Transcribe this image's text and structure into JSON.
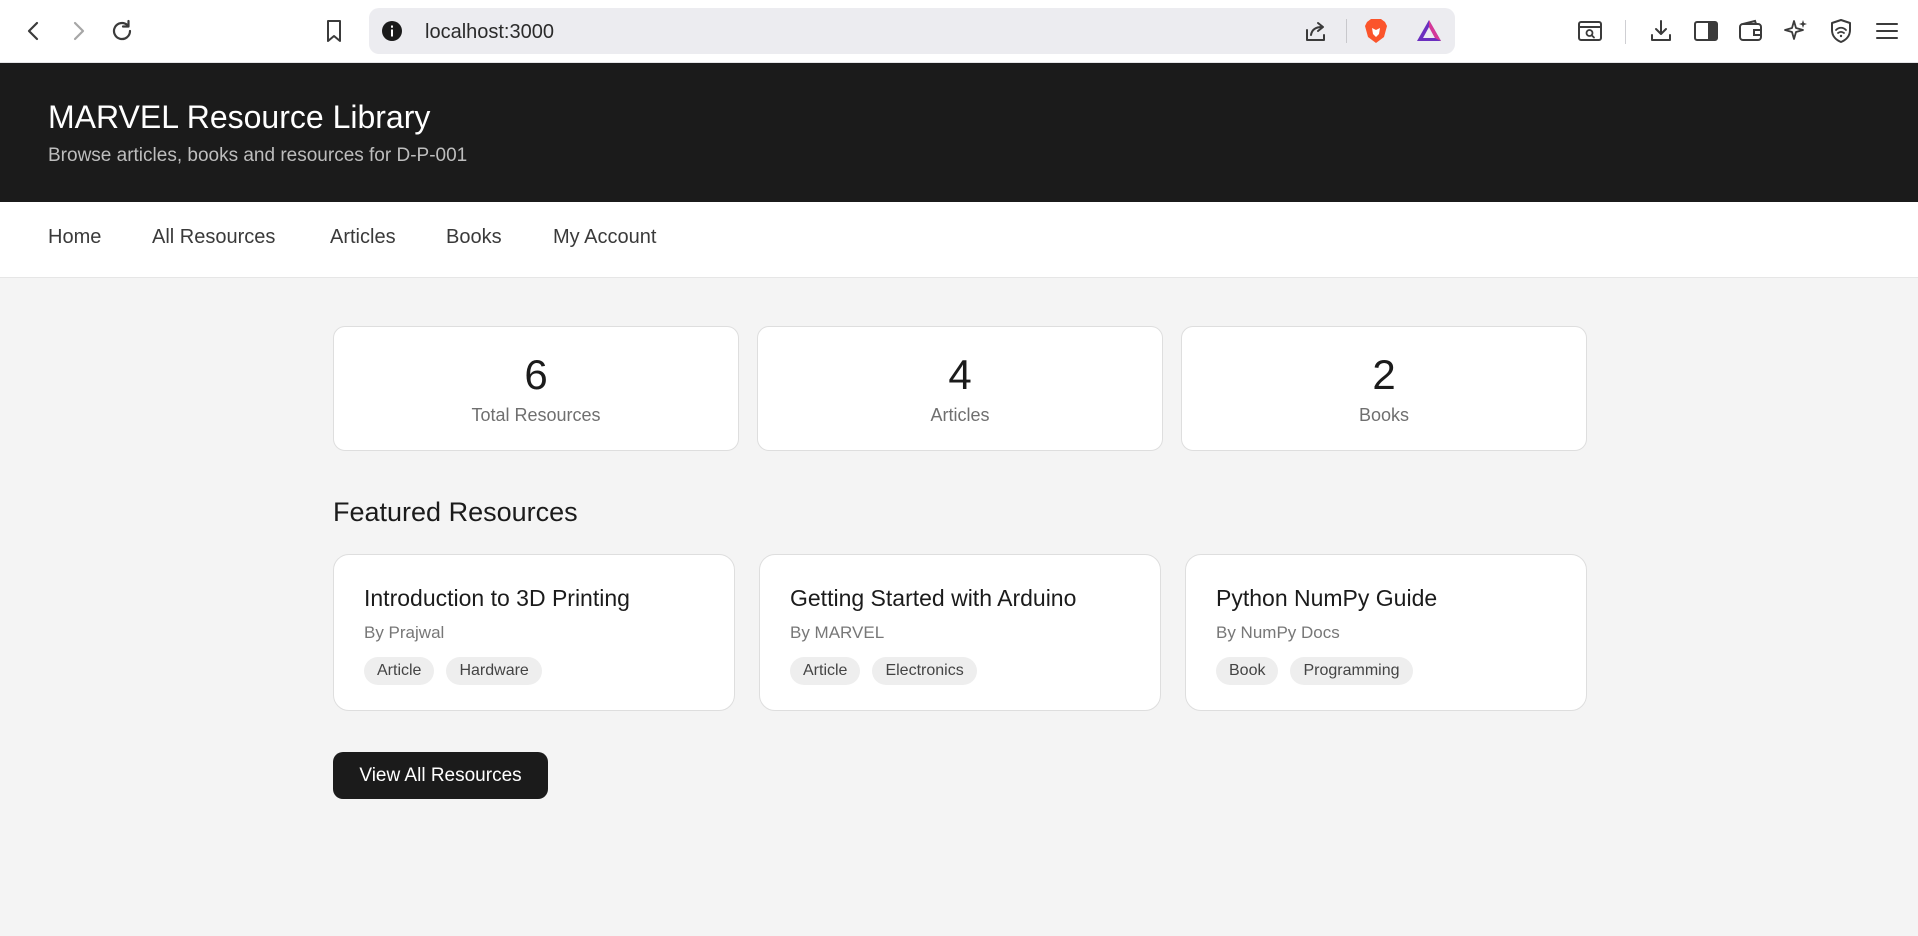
{
  "browser": {
    "url": "localhost:3000",
    "icons": [
      "back-icon",
      "forward-icon",
      "reload-icon",
      "bookmark-icon",
      "info-icon",
      "share-icon",
      "brave-shield-icon",
      "brave-rewards-icon",
      "tab-search-icon",
      "download-icon",
      "sidebar-icon",
      "wallet-icon",
      "leo-ai-icon",
      "vpn-icon",
      "menu-icon"
    ],
    "colors": {
      "brave_orange": "#fb542b",
      "rewards_purple": "#6b2fbf"
    }
  },
  "header": {
    "title": "MARVEL Resource Library",
    "subtitle": "Browse articles, books and resources for D-P-001"
  },
  "nav": {
    "items": [
      "Home",
      "All Resources",
      "Articles",
      "Books",
      "My Account"
    ]
  },
  "stats": [
    {
      "value": "6",
      "label": "Total Resources"
    },
    {
      "value": "4",
      "label": "Articles"
    },
    {
      "value": "2",
      "label": "Books"
    }
  ],
  "featured": {
    "heading": "Featured Resources",
    "items": [
      {
        "title": "Introduction to 3D Printing",
        "author": "By Prajwal",
        "tags": [
          "Article",
          "Hardware"
        ]
      },
      {
        "title": "Getting Started with Arduino",
        "author": "By MARVEL",
        "tags": [
          "Article",
          "Electronics"
        ]
      },
      {
        "title": "Python NumPy Guide",
        "author": "By NumPy Docs",
        "tags": [
          "Book",
          "Programming"
        ]
      }
    ]
  },
  "actions": {
    "view_all_label": "View All Resources"
  },
  "theme": {
    "dark": "#1b1b1b",
    "background": "#f4f4f4",
    "card": "#ffffff"
  }
}
